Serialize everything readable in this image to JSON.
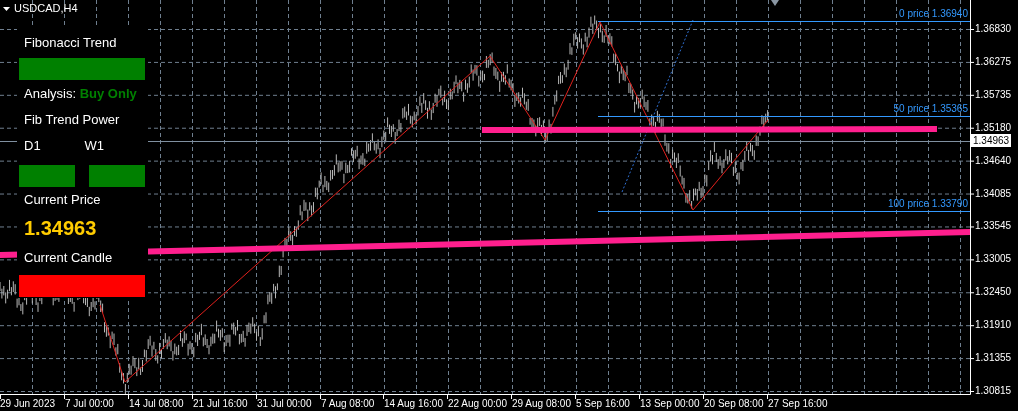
{
  "chart": {
    "title": "USDCAD,H4",
    "price_ticks": [
      "1.36830",
      "1.36275",
      "1.35735",
      "1.35180",
      "1.34640",
      "1.34085",
      "1.33545",
      "1.33005",
      "1.32450",
      "1.31910",
      "1.31355",
      "1.30815"
    ],
    "time_ticks": [
      "29 Jun 2023",
      "7 Jul 00:00",
      "14 Jul 08:00",
      "21 Jul 16:00",
      "31 Jul 00:00",
      "7 Aug 08:00",
      "14 Aug 16:00",
      "22 Aug 00:00",
      "29 Aug 08:00",
      "5 Sep 16:00",
      "13 Sep 00:00",
      "20 Sep 08:00",
      "27 Sep 16:00"
    ],
    "fib_levels": [
      {
        "label": "0 price 1.36940"
      },
      {
        "label": "50 price 1.35365"
      },
      {
        "label": "100 price 1.33790"
      }
    ],
    "current_price": "1.34963"
  },
  "panel": {
    "title": "Fibonacci Trend",
    "status_bars": [
      {
        "color": "#008000"
      },
      {
        "color": "#ff0000"
      }
    ],
    "analysis_label": "Analysis:",
    "analysis_value": "Buy Only",
    "power_title": "Fib Trend Power",
    "power": [
      {
        "label": "D1",
        "color": "#008000"
      },
      {
        "label": "W1",
        "color": "#008000"
      }
    ],
    "price_label": "Current Price",
    "price_value": "1.34963",
    "candle_label": "Current Candle"
  }
}
